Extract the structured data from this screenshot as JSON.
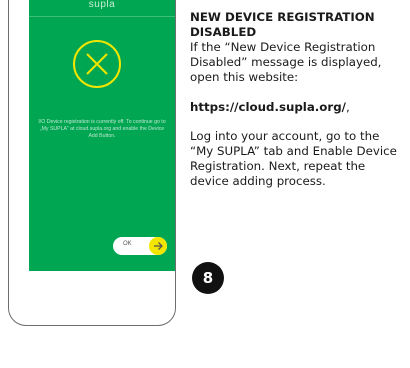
{
  "phone": {
    "app_title": "supla",
    "message": "I/O Device registration is currently off. To continue go to „My SUPLA” at cloud.supla.org and enable the Device Add Button.",
    "ok_label": "OK"
  },
  "instructions": {
    "heading": "NEW DEVICE REGISTRATION DISABLED",
    "intro": "If the “New Device Registration Disabled” message is displayed, open this website:",
    "url": "https://cloud.supla.org/",
    "url_suffix": ",",
    "body": "Log into your account, go to the “My SUPLA” tab and Enable Device Registration. Next, repeat the device adding process."
  },
  "step": {
    "number": "8"
  },
  "colors": {
    "screen_green": "#00a651",
    "accent_yellow": "#f2e600",
    "badge_black": "#111111"
  }
}
